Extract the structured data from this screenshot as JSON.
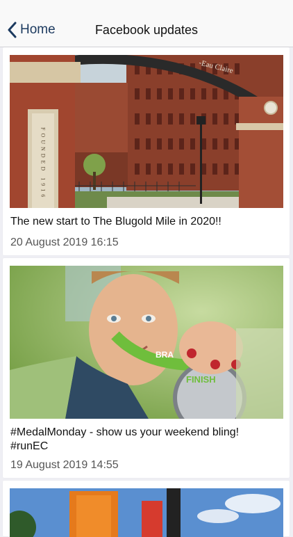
{
  "nav": {
    "back_label": "Home",
    "title": "Facebook updates"
  },
  "posts": [
    {
      "text": "The new start to The Blugold Mile in 2020!!",
      "date": "20 August 2019 16:15",
      "image_alt": "Brick campus gate arch",
      "image_text": {
        "pillar": "FOUNDED 1916",
        "arch": "-Eau Claire"
      }
    },
    {
      "text": "#MedalMonday - show us your weekend bling!\n#runEC",
      "date": "19 August 2019 14:55",
      "image_alt": "Child holding a finisher medal",
      "image_text": {
        "ribbon": "BRA",
        "medal": "FINISH"
      }
    },
    {
      "text": "",
      "date": "",
      "image_alt": "Race finish arch and sky"
    }
  ],
  "colors": {
    "accent": "#1c3a5f",
    "background": "#efeff4"
  },
  "icons": {
    "back": "chevron-left-icon"
  }
}
